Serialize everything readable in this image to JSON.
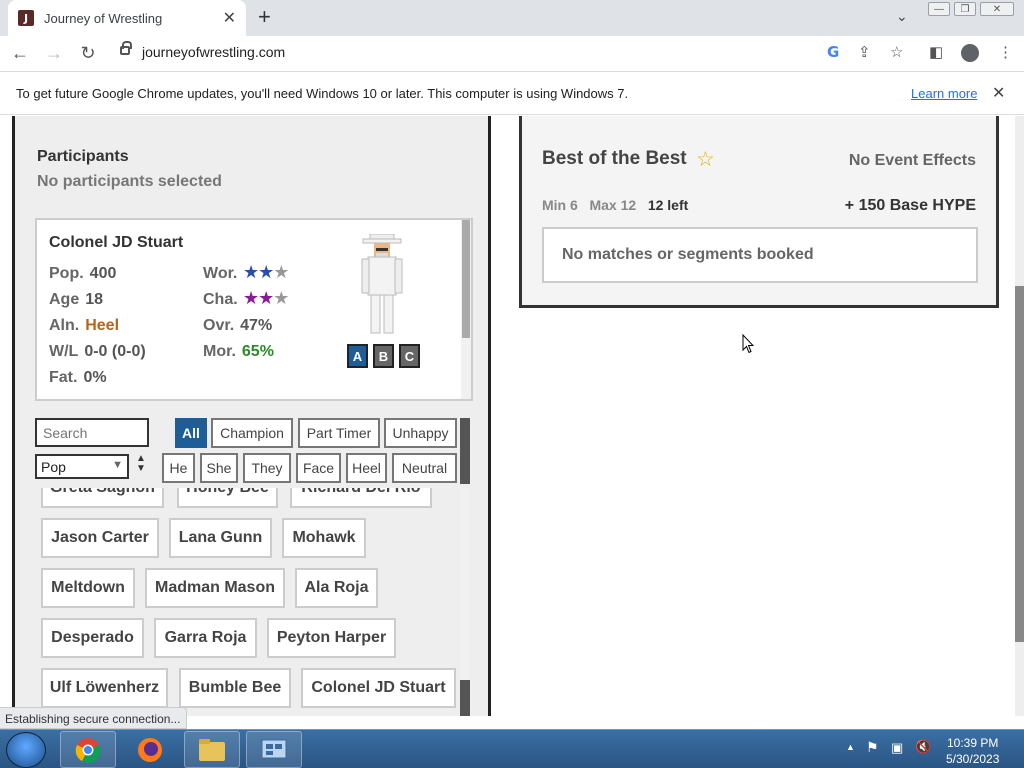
{
  "browser": {
    "tab_title": "Journey of Wrestling",
    "tab_favicon_letter": "J",
    "url": "journeyofwrestling.com",
    "infobar_text": "To get future Google Chrome updates, you'll need Windows 10 or later. This computer is using Windows 7.",
    "infobar_link": "Learn more",
    "status_text": "Establishing secure connection..."
  },
  "participants": {
    "title": "Participants",
    "subtitle": "No participants selected"
  },
  "wrestler_card": {
    "name": "Colonel JD Stuart",
    "stats_left": [
      {
        "label": "Pop.",
        "value": "400"
      },
      {
        "label": "Age",
        "value": "18"
      },
      {
        "label": "Aln.",
        "value": "Heel"
      },
      {
        "label": "W/L",
        "value": "0-0 (0-0)"
      },
      {
        "label": "Fat.",
        "value": "0%"
      }
    ],
    "stats_right": [
      {
        "label": "Wor.",
        "stars": 2,
        "of": 3,
        "color": "#2a4fa8"
      },
      {
        "label": "Cha.",
        "stars": 2,
        "of": 3,
        "color": "#8a1a9a"
      },
      {
        "label": "Ovr.",
        "value": "47%"
      },
      {
        "label": "Mor.",
        "value": "65%"
      }
    ],
    "slot_buttons": [
      "A",
      "B",
      "C"
    ]
  },
  "filters": {
    "search_placeholder": "Search",
    "sort_value": "Pop",
    "row1": [
      "All",
      "Champion",
      "Part Timer",
      "Unhappy"
    ],
    "row2": [
      "He",
      "She",
      "They",
      "Face",
      "Heel",
      "Neutral"
    ]
  },
  "roster": {
    "cut_row": [
      "Greta Sagnon",
      "Honey Bee",
      "Richard Del Rio"
    ],
    "rows": [
      [
        "Jason Carter",
        "Lana Gunn",
        "Mohawk"
      ],
      [
        "Meltdown",
        "Madman Mason",
        "Ala Roja"
      ],
      [
        "Desperado",
        "Garra Roja",
        "Peyton Harper"
      ],
      [
        "Ulf Löwenherz",
        "Bumble Bee",
        "Colonel JD Stuart"
      ]
    ]
  },
  "event": {
    "title": "Best of the Best",
    "effects": "No Event Effects",
    "min": "Min 6",
    "max": "Max 12",
    "left": "12 left",
    "hype": "+ 150 Base HYPE",
    "booked": "No matches or segments booked"
  },
  "taskbar": {
    "time": "10:39 PM",
    "date": "5/30/2023"
  }
}
